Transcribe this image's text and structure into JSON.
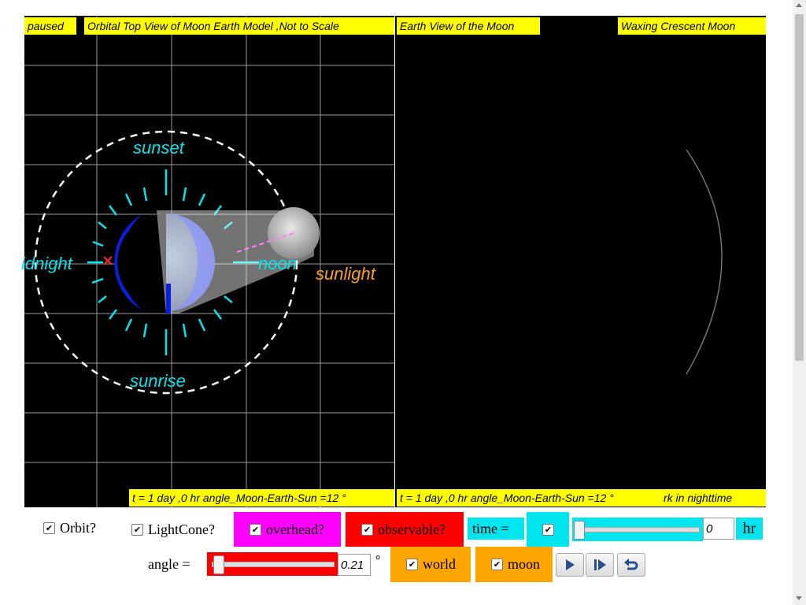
{
  "left_panel": {
    "status": "paused",
    "title": "Orbital Top View of Moon Earth Model ,Not to Scale",
    "labels": {
      "sunset": "sunset",
      "midnight": "idnight",
      "noon": "noon",
      "sunrise": "sunrise",
      "sunlight": "sunlight"
    },
    "bottom_readout": "t = 1 day ,0 hr angle_Moon-Earth-Sun =12 °"
  },
  "right_panel": {
    "title": "Earth View of the Moon",
    "phase": "Waxing Crescent Moon",
    "bottom_readout": "t = 1 day ,0 hr angle_Moon-Earth-Sun =12 °",
    "bottom_note": "rk in nighttime"
  },
  "controls": {
    "orbit": {
      "label": "Orbit?",
      "checked": true
    },
    "lightcone": {
      "label": "LightCone?",
      "checked": true
    },
    "overhead": {
      "label": "overhead?",
      "checked": true
    },
    "observable": {
      "label": "observable?",
      "checked": true
    },
    "time": {
      "label": "time =",
      "checked": true,
      "value": "0",
      "unit": "hr",
      "fraction": 0
    },
    "angle": {
      "label": "angle =",
      "value": "0.21",
      "unit": "°",
      "fraction": 0.02
    },
    "world": {
      "label": "world",
      "checked": true
    },
    "moon": {
      "label": "moon",
      "checked": true
    }
  },
  "colors": {
    "label_yellow": "#ffff00",
    "cyan": "#00e5ee",
    "magenta": "#ff00ff",
    "red": "#ff0000",
    "orange": "#ffa500",
    "sunlight": "#ff9f1a"
  },
  "icons": [
    "play-icon",
    "step-icon",
    "reset-icon"
  ]
}
